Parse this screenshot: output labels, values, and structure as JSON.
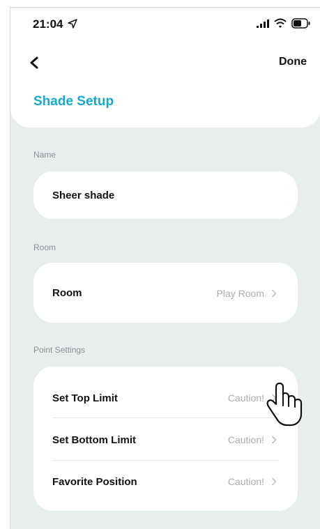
{
  "statusbar": {
    "time": "21:04"
  },
  "header": {
    "done_label": "Done",
    "title": "Shade Setup"
  },
  "sections": {
    "name": {
      "label": "Name",
      "value": "Sheer shade"
    },
    "room": {
      "label": "Room",
      "row_title": "Room",
      "row_value": "Play Room"
    },
    "point_settings": {
      "label": "Point Settings",
      "rows": [
        {
          "title": "Set Top Limit",
          "value": "Caution!"
        },
        {
          "title": "Set Bottom Limit",
          "value": "Caution!"
        },
        {
          "title": "Favorite Position",
          "value": "Caution!"
        }
      ]
    }
  },
  "colors": {
    "accent": "#17a8cf",
    "background": "#e8eeee",
    "muted": "#a8adb0"
  },
  "icons": [
    "location-arrow-icon",
    "signal-icon",
    "wifi-icon",
    "battery-icon",
    "back-chevron-icon",
    "chevron-right-icon",
    "hand-pointer-icon"
  ]
}
